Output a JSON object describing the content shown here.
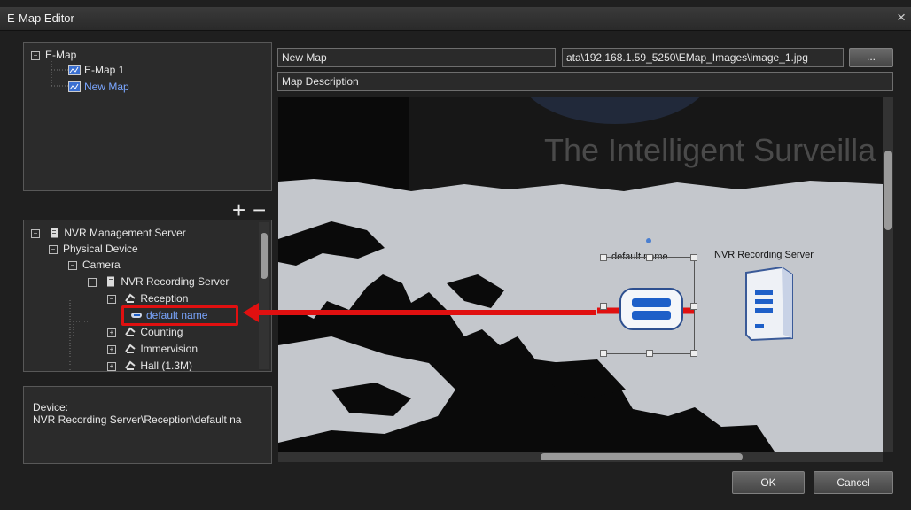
{
  "window": {
    "title": "E-Map Editor",
    "close_glyph": "×"
  },
  "emap_tree": {
    "root": "E-Map",
    "items": [
      {
        "label": "E-Map 1",
        "icon": "map-icon"
      },
      {
        "label": "New Map",
        "icon": "map-icon",
        "selected": true
      }
    ]
  },
  "tree_controls": {
    "add": "+",
    "remove": "−"
  },
  "device_tree": {
    "items": [
      {
        "label": "NVR Management Server",
        "icon": "server-icon",
        "level": 0
      },
      {
        "label": "Physical Device",
        "level": 1
      },
      {
        "label": "Camera",
        "level": 2
      },
      {
        "label": "NVR Recording Server",
        "icon": "server-icon",
        "level": 3
      },
      {
        "label": "Reception",
        "icon": "camera-icon",
        "level": 4
      },
      {
        "label": "default name",
        "icon": "camera-icon",
        "level": 5,
        "highlighted": true
      },
      {
        "label": "Counting",
        "icon": "camera-icon",
        "level": 4
      },
      {
        "label": "Immervision",
        "icon": "camera-icon",
        "level": 4
      },
      {
        "label": "Hall (1.3M)",
        "icon": "camera-icon",
        "level": 4
      }
    ]
  },
  "device_info": {
    "label": "Device:",
    "path": "NVR Recording Server\\Reception\\default na"
  },
  "map_form": {
    "name_value": "New Map",
    "path_value": "ata\\192.168.1.59_5250\\EMap_Images\\image_1.jpg",
    "browse_label": "...",
    "description_value": "Map Description"
  },
  "map_canvas": {
    "banner_text": "The Intelligent Surveilla",
    "camera_label": "default name",
    "server_label": "NVR Recording Server"
  },
  "buttons": {
    "ok": "OK",
    "cancel": "Cancel"
  },
  "colors": {
    "highlight_arrow": "#e01010",
    "selected_text": "#7aa6ff",
    "device_icon": "#1e5fc8"
  }
}
